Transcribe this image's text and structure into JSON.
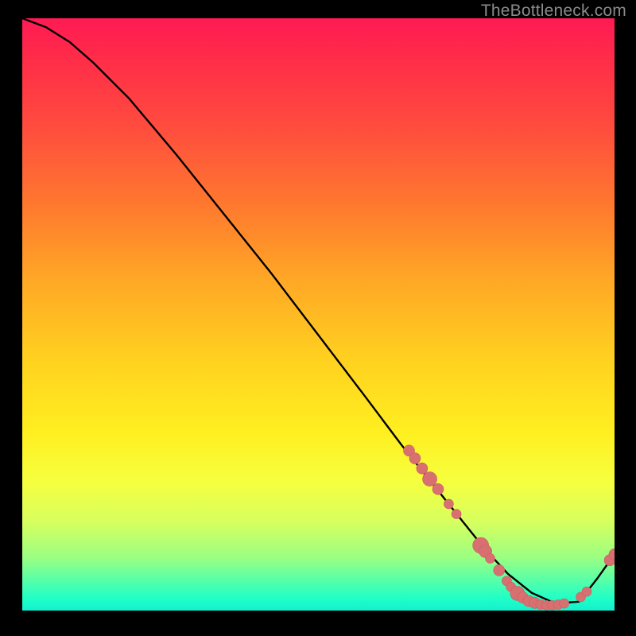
{
  "watermark": "TheBottleneck.com",
  "colors": {
    "background": "#000000",
    "curve": "#000000",
    "point_fill": "#d87071",
    "point_stroke": "#c85c5d"
  },
  "chart_data": {
    "type": "line",
    "title": "",
    "xlabel": "",
    "ylabel": "",
    "xlim": [
      0,
      100
    ],
    "ylim": [
      0,
      100
    ],
    "curve": {
      "x": [
        0,
        4,
        8,
        12,
        18,
        26,
        34,
        42,
        50,
        58,
        64,
        70,
        74,
        78,
        82,
        86,
        90,
        94,
        97,
        100
      ],
      "y": [
        100,
        98.5,
        96,
        92.5,
        86.5,
        77,
        67,
        57,
        46.5,
        36,
        28,
        20.5,
        15.5,
        10.5,
        6.2,
        3,
        1.2,
        1.5,
        5.3,
        9.5
      ]
    },
    "points": [
      {
        "x": 65.3,
        "y": 27.0,
        "r": 7
      },
      {
        "x": 66.3,
        "y": 25.7,
        "r": 7
      },
      {
        "x": 67.5,
        "y": 24.0,
        "r": 7
      },
      {
        "x": 68.8,
        "y": 22.2,
        "r": 9
      },
      {
        "x": 70.2,
        "y": 20.5,
        "r": 7
      },
      {
        "x": 72.0,
        "y": 18.0,
        "r": 6
      },
      {
        "x": 73.3,
        "y": 16.3,
        "r": 6
      },
      {
        "x": 77.4,
        "y": 11.0,
        "r": 10
      },
      {
        "x": 78.2,
        "y": 10.0,
        "r": 8
      },
      {
        "x": 79.0,
        "y": 8.8,
        "r": 6
      },
      {
        "x": 80.5,
        "y": 6.8,
        "r": 7
      },
      {
        "x": 81.8,
        "y": 5.0,
        "r": 6
      },
      {
        "x": 82.5,
        "y": 4.0,
        "r": 6
      },
      {
        "x": 83.6,
        "y": 2.9,
        "r": 9
      },
      {
        "x": 84.5,
        "y": 2.2,
        "r": 7
      },
      {
        "x": 85.5,
        "y": 1.6,
        "r": 7
      },
      {
        "x": 86.5,
        "y": 1.3,
        "r": 7
      },
      {
        "x": 87.5,
        "y": 1.0,
        "r": 6
      },
      {
        "x": 88.5,
        "y": 0.9,
        "r": 6
      },
      {
        "x": 89.5,
        "y": 0.9,
        "r": 6
      },
      {
        "x": 90.5,
        "y": 1.0,
        "r": 6
      },
      {
        "x": 91.5,
        "y": 1.2,
        "r": 6
      },
      {
        "x": 94.3,
        "y": 2.3,
        "r": 6
      },
      {
        "x": 95.3,
        "y": 3.2,
        "r": 6
      },
      {
        "x": 99.2,
        "y": 8.5,
        "r": 7
      },
      {
        "x": 100.0,
        "y": 9.5,
        "r": 7
      }
    ]
  }
}
